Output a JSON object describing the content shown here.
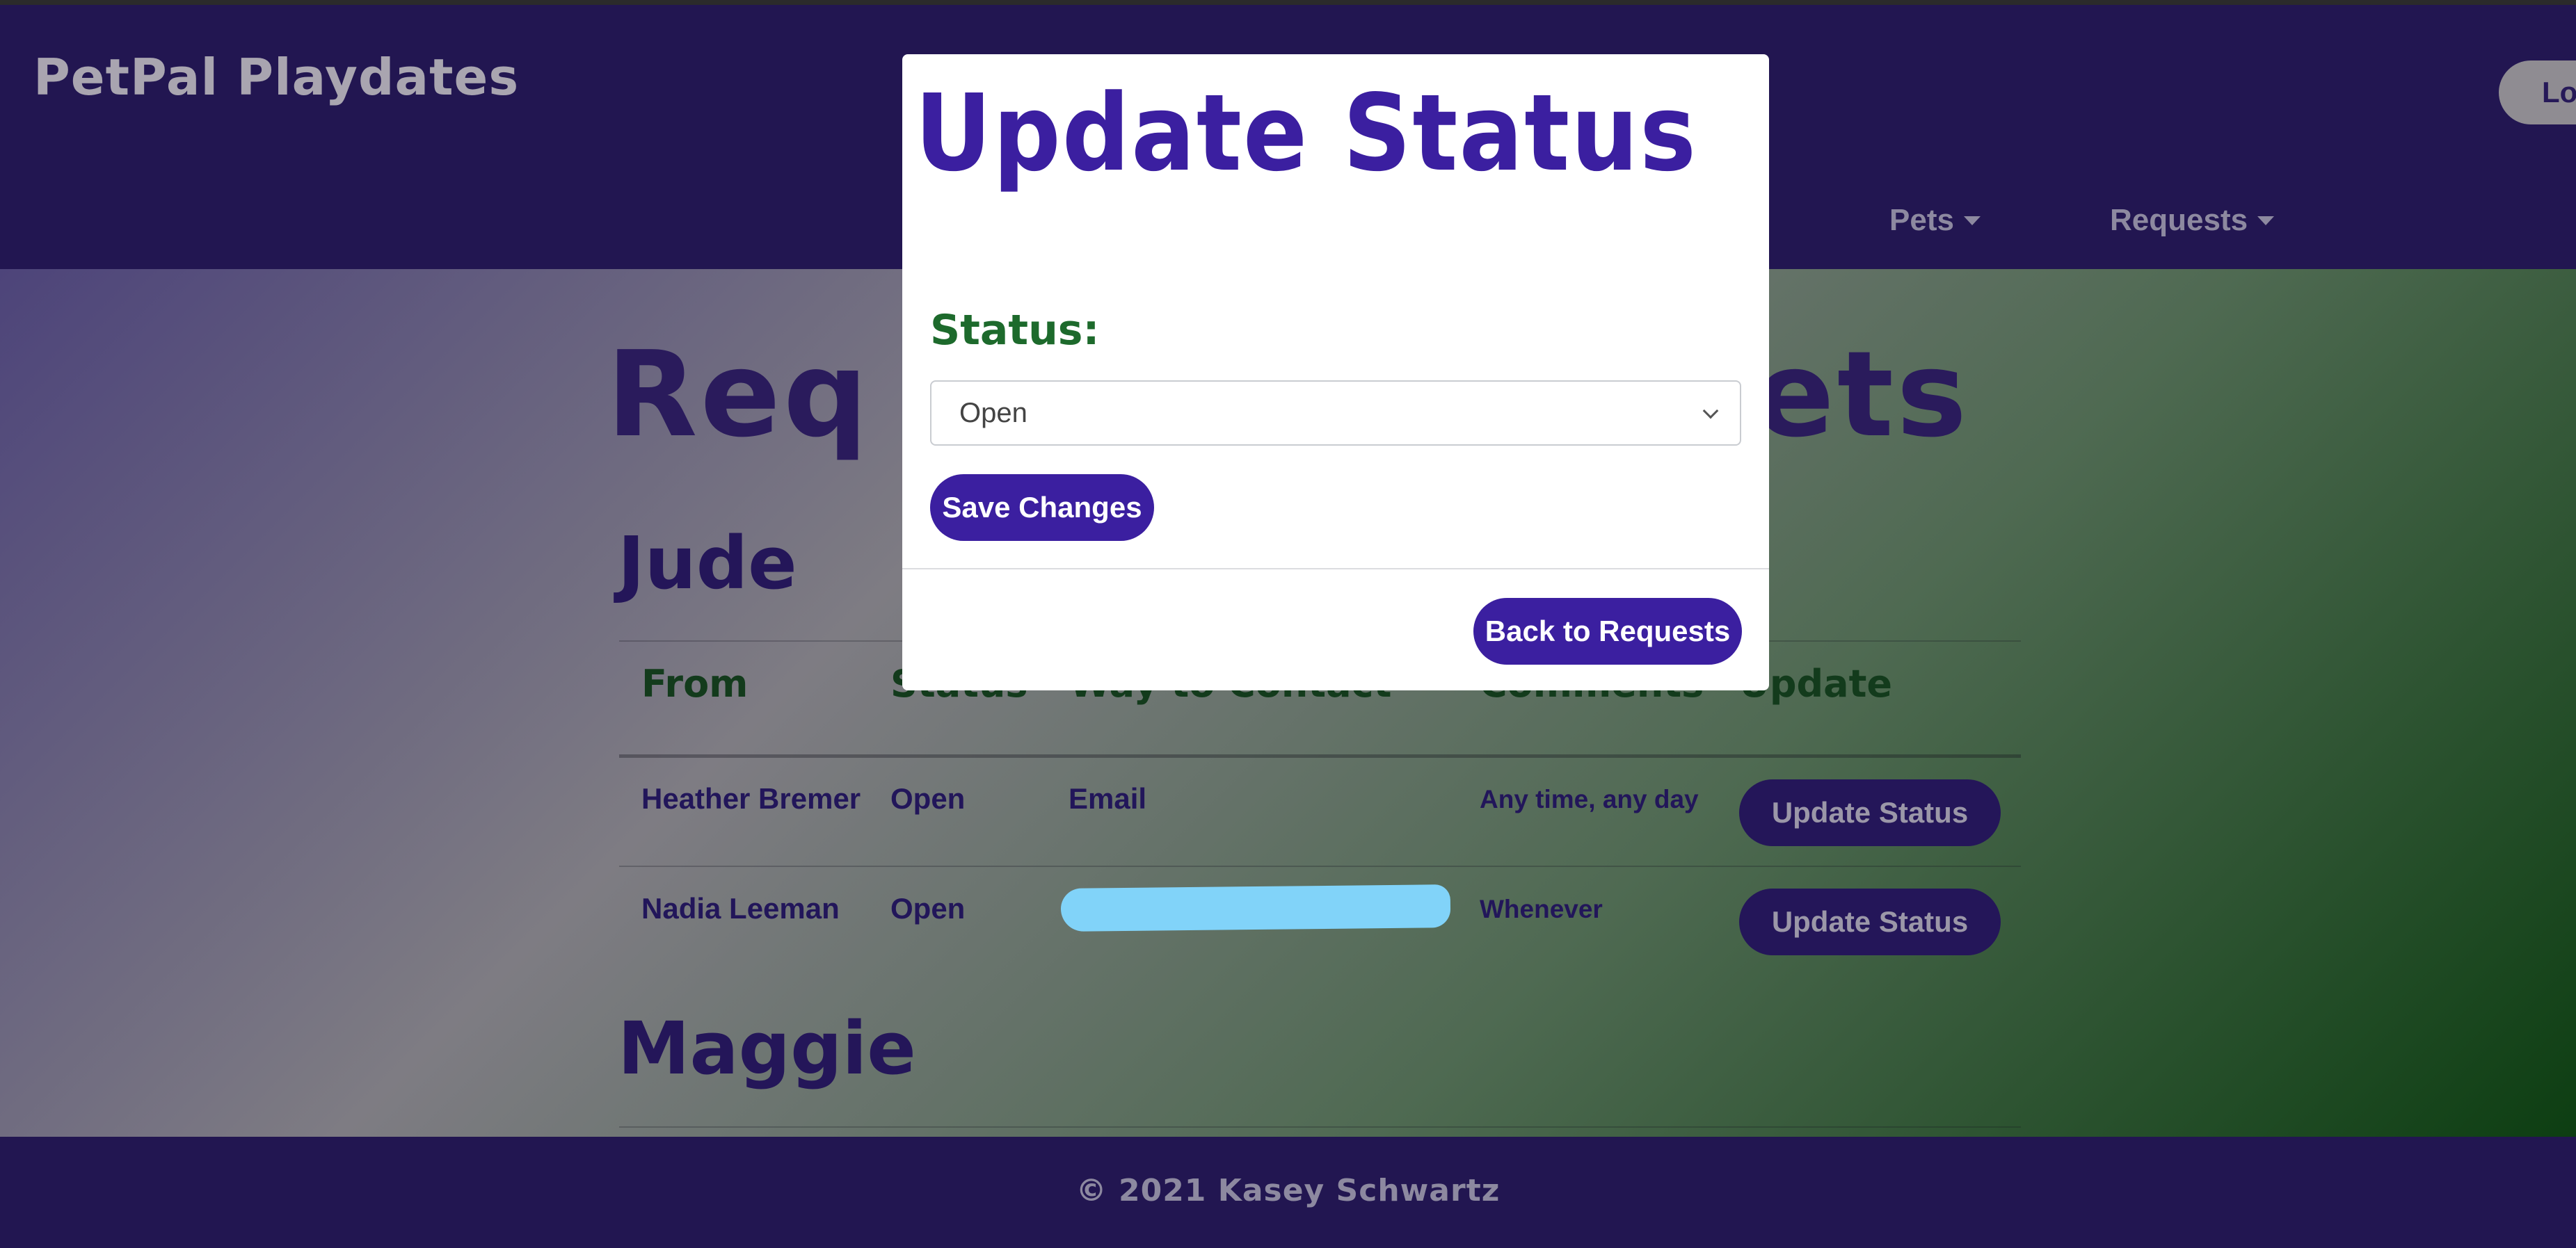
{
  "app": {
    "brand": "PetPal Playdates",
    "logout_label": "Logo"
  },
  "nav": {
    "items": [
      {
        "label": "Pets"
      },
      {
        "label": "Requests"
      }
    ]
  },
  "page": {
    "title_left": "Req",
    "title_right": "ets",
    "pets": [
      {
        "name": "Jude",
        "columns": [
          "From",
          "Status",
          "Way to Contact",
          "Comments",
          "Update"
        ],
        "rows": [
          {
            "from": "Heather Bremer",
            "status": "Open",
            "contact": "Email",
            "comments": "Any time, any day",
            "action": "Update Status"
          },
          {
            "from": "Nadia Leeman",
            "status": "Open",
            "contact": "",
            "comments": "Whenever",
            "action": "Update Status"
          }
        ]
      },
      {
        "name": "Maggie"
      }
    ]
  },
  "modal": {
    "title": "Update Status",
    "status_label": "Status:",
    "status_value": "Open",
    "save_label": "Save Changes",
    "back_label": "Back to Requests"
  },
  "footer": {
    "text": "© 2021 Kasey Schwartz"
  },
  "colors": {
    "navbar": "#221651",
    "primary_button": "#3b1fa0",
    "modal_title": "#3b1fa0",
    "status_label": "#1d6a2c",
    "redaction": "#81d3f9"
  }
}
